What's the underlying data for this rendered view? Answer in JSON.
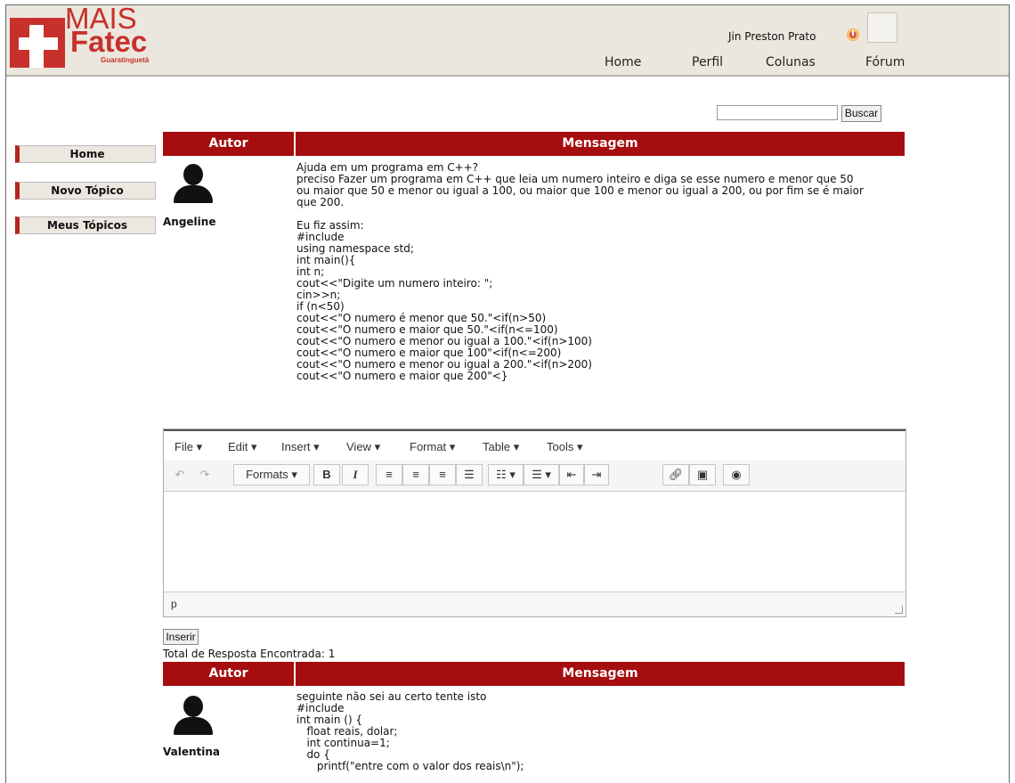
{
  "header": {
    "logo": {
      "line1": "MAIS",
      "line2": "Fatec",
      "line3": "Guaratinguetá"
    },
    "user_name": "Jin Preston Prato",
    "nav": [
      "Home",
      "Perfil",
      "Colunas",
      "Fórum"
    ]
  },
  "search": {
    "button_label": "Buscar",
    "value": ""
  },
  "sidebar": {
    "items": [
      "Home",
      "Novo Tópico",
      "Meus Tópicos"
    ]
  },
  "topic": {
    "headers": {
      "author": "Autor",
      "message": "Mensagem"
    },
    "author": "Angeline",
    "message": "Ajuda em um programa em C++?\npreciso Fazer um programa em C++ que leia um numero inteiro e diga se esse numero e menor que 50\nou maior que 50 e menor ou igual a 100, ou maior que 100 e menor ou igual a 200, ou por fim se é maior\nque 200.\n\nEu fiz assim:\n#include\nusing namespace std;\nint main(){\nint n;\ncout<<\"Digite um numero inteiro: \";\ncin>>n;\nif (n<50)\ncout<<\"O numero é menor que 50.\"<if(n>50)\ncout<<\"O numero e maior que 50.\"<if(n<=100)\ncout<<\"O numero e menor ou igual a 100.\"<if(n>100)\ncout<<\"O numero e maior que 100\"<if(n<=200)\ncout<<\"O numero e menor ou igual a 200.\"<if(n>200)\ncout<<\"O numero e maior que 200\"<}"
  },
  "editor": {
    "menus": [
      "File",
      "Edit",
      "Insert",
      "View",
      "Format",
      "Table",
      "Tools"
    ],
    "formats_label": "Formats",
    "status_path": "p"
  },
  "insert_button": "Inserir",
  "total_label": "Total de Resposta Encontrada: 1",
  "reply": {
    "headers": {
      "author": "Autor",
      "message": "Mensagem"
    },
    "author": "Valentina",
    "message": "seguinte não sei au certo tente isto\n#include\nint main () {\n   float reais, dolar;\n   int continua=1;\n   do {\n      printf(\"entre com o valor dos reais\\n\");"
  }
}
